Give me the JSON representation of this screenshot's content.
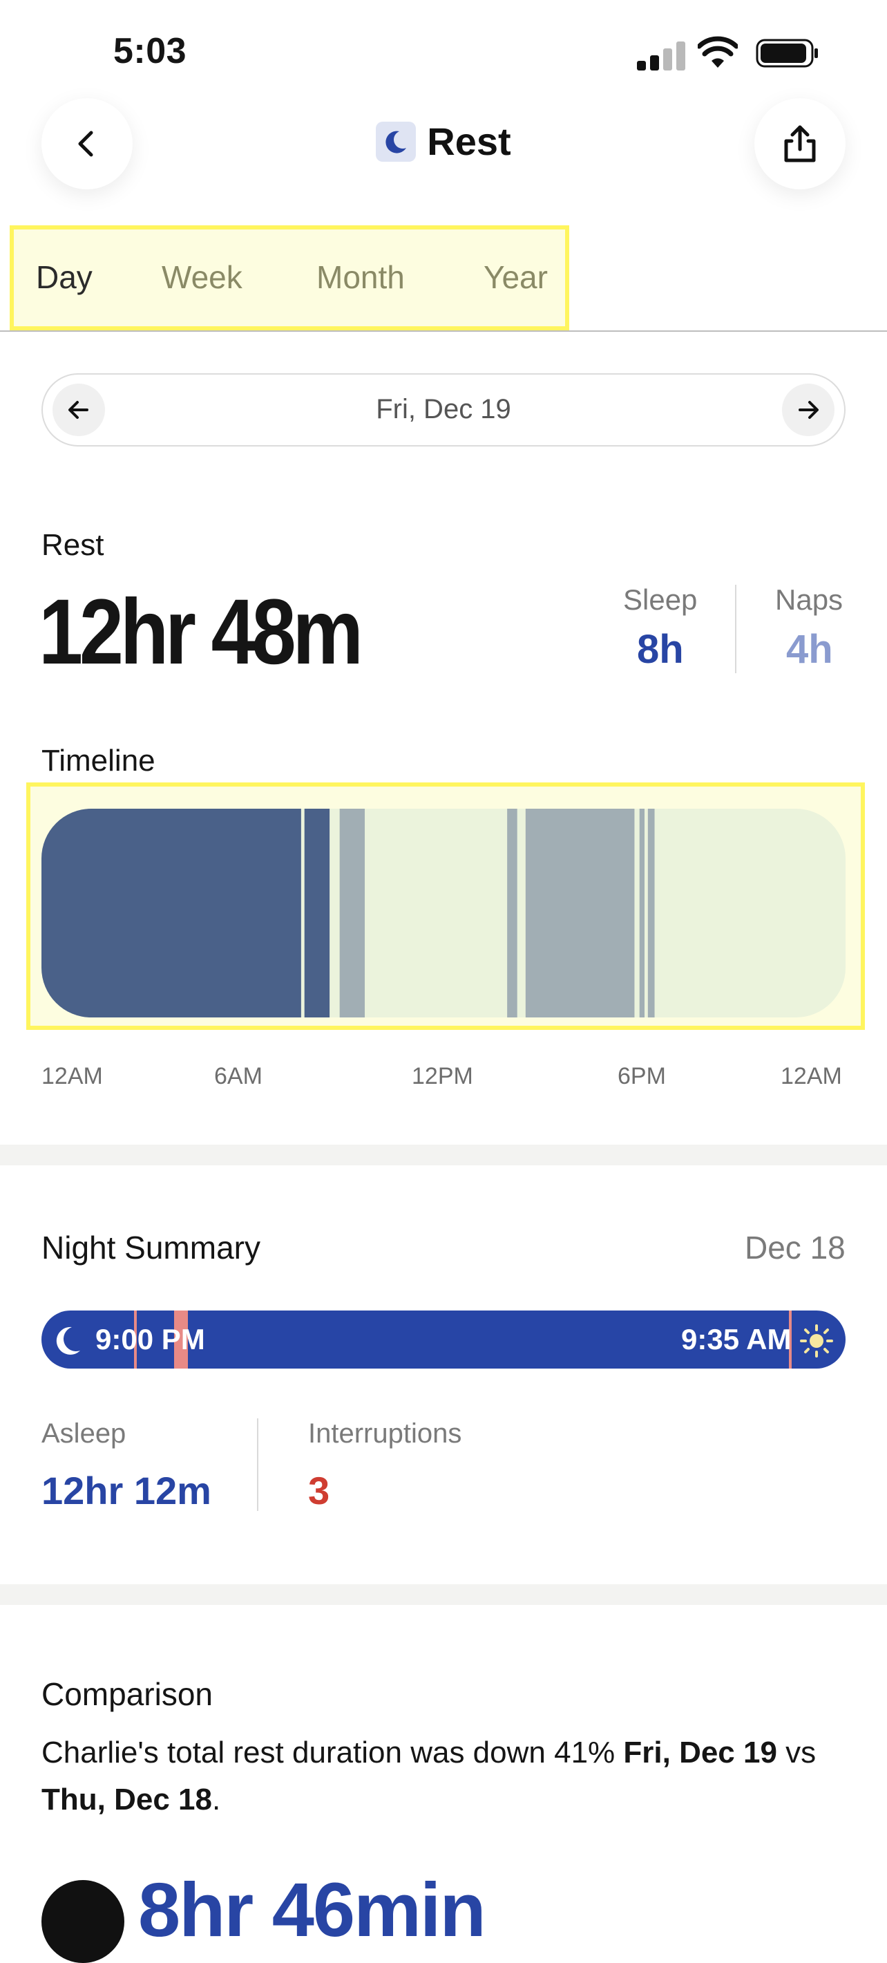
{
  "status_bar": {
    "time": "5:03"
  },
  "header": {
    "title": "Rest",
    "icon": "moon-icon",
    "back_icon": "chevron-left-icon",
    "share_icon": "share-icon"
  },
  "tabs": [
    {
      "label": "Day",
      "active": true
    },
    {
      "label": "Week",
      "active": false
    },
    {
      "label": "Month",
      "active": false
    },
    {
      "label": "Year",
      "active": false
    }
  ],
  "date_selector": {
    "label": "Fri, Dec 19"
  },
  "rest": {
    "label": "Rest",
    "total": "12hr 48m",
    "sleep_label": "Sleep",
    "sleep_value": "8h",
    "naps_label": "Naps",
    "naps_value": "4h"
  },
  "timeline": {
    "label": "Timeline",
    "ticks": [
      "12AM",
      "6AM",
      "12PM",
      "6PM",
      "12AM"
    ],
    "colors": {
      "sleep": "#4a6189",
      "nap": "#a1aeb4",
      "awake": "#ebf3dc"
    },
    "segments": [
      {
        "type": "sleep",
        "start_hr": 0.0,
        "end_hr": 7.75
      },
      {
        "type": "sleep",
        "start_hr": 7.85,
        "end_hr": 8.6
      },
      {
        "type": "nap",
        "start_hr": 8.9,
        "end_hr": 9.65
      },
      {
        "type": "nap",
        "start_hr": 13.9,
        "end_hr": 14.2
      },
      {
        "type": "nap",
        "start_hr": 14.45,
        "end_hr": 17.7
      },
      {
        "type": "nap",
        "start_hr": 17.85,
        "end_hr": 18.0
      },
      {
        "type": "nap",
        "start_hr": 18.1,
        "end_hr": 18.3
      }
    ]
  },
  "night_summary": {
    "title": "Night Summary",
    "date": "Dec 18",
    "start": "9:00 PM",
    "end": "9:35 AM",
    "asleep_label": "Asleep",
    "asleep_value": "12hr 12m",
    "interruptions_label": "Interruptions",
    "interruptions_value": "3",
    "colors": {
      "bar": "#2745a6",
      "interruption": "#e88a86"
    }
  },
  "comparison": {
    "title": "Comparison",
    "text_prefix": "Charlie's total rest duration was down 41% ",
    "text_bold_1": "Fri, Dec 19",
    "text_middle": " vs ",
    "text_bold_2": "Thu, Dec 18",
    "text_suffix": ".",
    "value": "8hr 46min"
  }
}
